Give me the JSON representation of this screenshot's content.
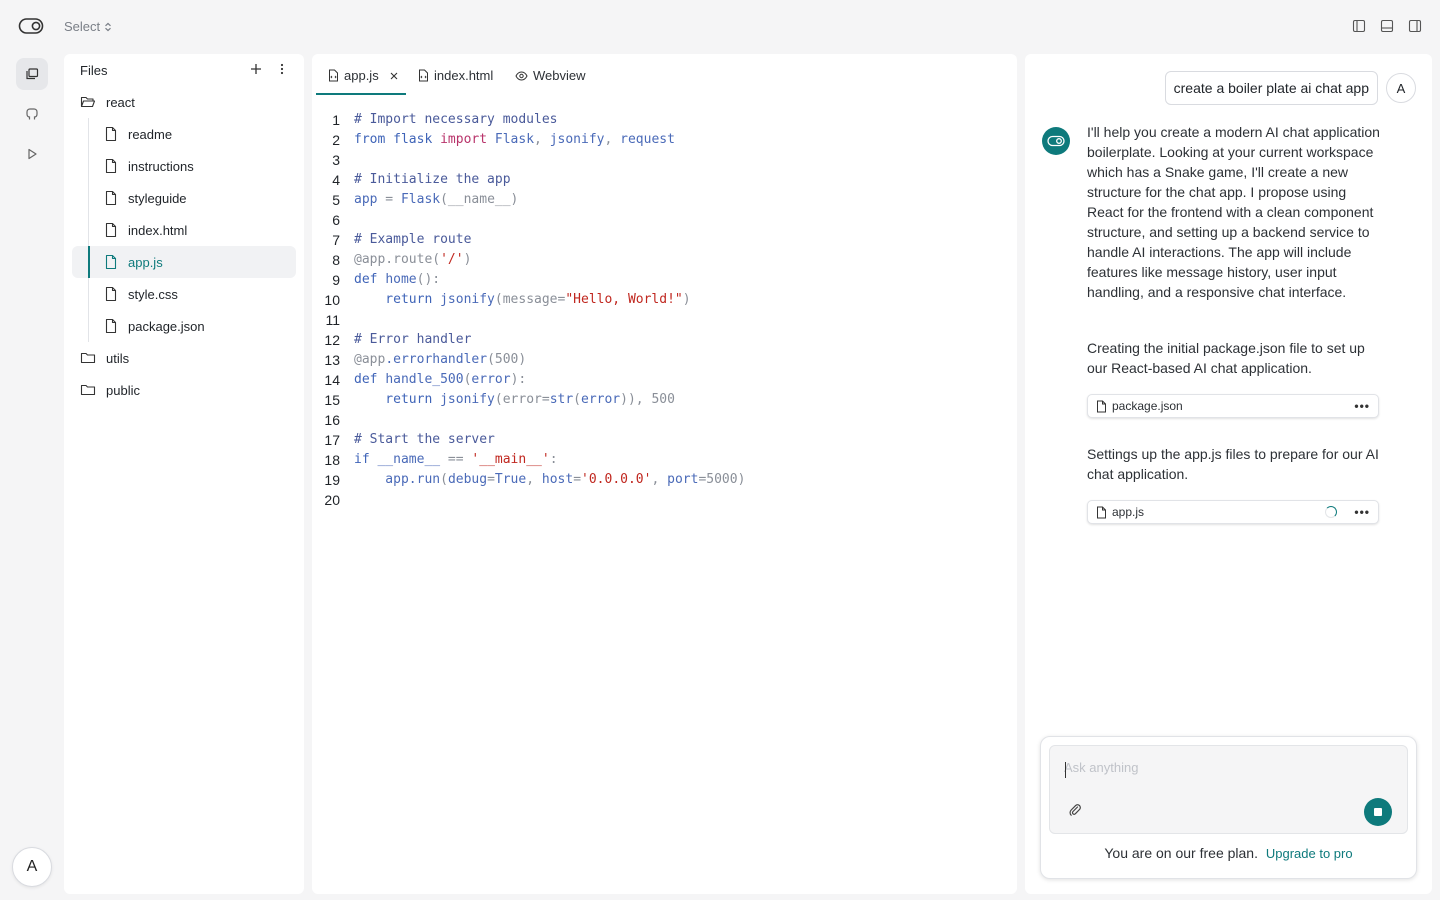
{
  "topbar": {
    "select_label": "Select"
  },
  "rail": {
    "avatar_letter": "A"
  },
  "files": {
    "title": "Files",
    "tree": [
      {
        "label": "react",
        "type": "folder"
      },
      {
        "label": "readme",
        "type": "file"
      },
      {
        "label": "instructions",
        "type": "file"
      },
      {
        "label": "styleguide",
        "type": "file"
      },
      {
        "label": "index.html",
        "type": "file"
      },
      {
        "label": "app.js",
        "type": "file",
        "selected": true
      },
      {
        "label": "style.css",
        "type": "file"
      },
      {
        "label": "package.json",
        "type": "file"
      },
      {
        "label": "utils",
        "type": "folder"
      },
      {
        "label": "public",
        "type": "folder"
      }
    ]
  },
  "editor": {
    "tabs": [
      {
        "label": "app.js",
        "active": true
      },
      {
        "label": "index.html"
      },
      {
        "label": "Webview"
      }
    ],
    "line_numbers": [
      "1",
      "2",
      "3",
      "4",
      "5",
      "6",
      "7",
      "8",
      "9",
      "10",
      "11",
      "12",
      "13",
      "14",
      "15",
      "16",
      "17",
      "18",
      "19",
      "20"
    ],
    "code": {
      "l1": "# Import necessary modules",
      "l2_a": "from flask ",
      "l2_b": "import",
      "l2_c": " Flask",
      "l2_d": ", ",
      "l2_e": "jsonify",
      "l2_f": ", ",
      "l2_g": "request",
      "l4": "# Initialize the app",
      "l5_a": "app",
      "l5_b": " = ",
      "l5_c": "Flask",
      "l5_d": "(__name__)",
      "l7": "# Example route",
      "l8_a": "@app.route(",
      "l8_b": "'/'",
      "l8_c": ")",
      "l9_a": "def ",
      "l9_b": "home",
      "l9_c": "():",
      "l10_a": "    return ",
      "l10_b": "jsonify",
      "l10_c": "(message=",
      "l10_d": "\"Hello, World!\"",
      "l10_e": ")",
      "l12": "# Error handler",
      "l13_a": "@app",
      "l13_b": ".errorhandler",
      "l13_c": "(500)",
      "l14_a": "def ",
      "l14_b": "handle_500",
      "l14_c": "(",
      "l14_d": "error",
      "l14_e": "):",
      "l15_a": "    return ",
      "l15_b": "jsonify",
      "l15_c": "(error=",
      "l15_d": "str",
      "l15_e": "(",
      "l15_f": "error",
      "l15_g": ")), 500",
      "l17": "# Start the server",
      "l18_a": "if ",
      "l18_b": "__name__",
      "l18_c": " == ",
      "l18_d": "'__main__'",
      "l18_e": ":",
      "l19_a": "    app",
      "l19_b": ".run",
      "l19_c": "(",
      "l19_d": "debug",
      "l19_e": "=",
      "l19_f": "True",
      "l19_g": ", ",
      "l19_h": "host",
      "l19_i": "=",
      "l19_j": "'0.0.0.0'",
      "l19_k": ", ",
      "l19_l": "port",
      "l19_m": "=5000)"
    }
  },
  "chat": {
    "user_message": "create a boiler plate ai chat app",
    "user_avatar": "A",
    "messages": {
      "m1": "I'll help you create a modern AI chat application boilerplate. Looking at your current workspace which has a Snake game, I'll create a new structure for the chat app. I propose using React for the frontend with a clean component structure, and setting up a backend service to handle AI interactions. The app will include features like message history, user input handling, and a responsive chat interface.",
      "m2": "Creating the initial package.json file to set up our React-based AI chat application.",
      "m3": "Settings up the app.js files to prepare for our AI chat application."
    },
    "file_cards": {
      "c1": "package.json",
      "c2": "app.js",
      "more": "•••"
    },
    "composer": {
      "placeholder": "Ask anything",
      "value": "",
      "plan_text": "You are on our free plan.",
      "upgrade_link": "Upgrade to pro"
    }
  },
  "colors": {
    "accent": "#0e7a7c"
  }
}
